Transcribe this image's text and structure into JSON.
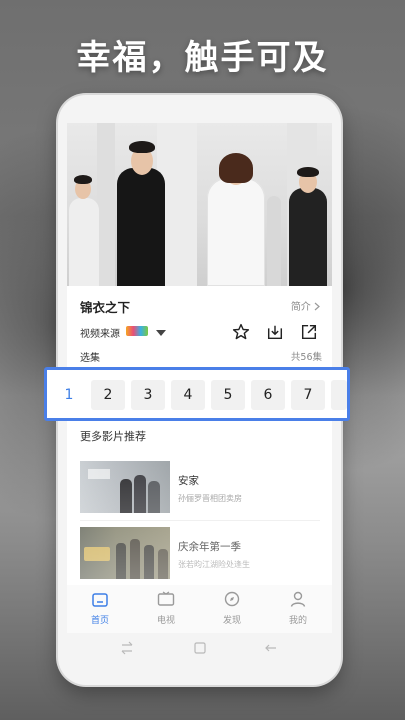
{
  "headline": "幸福，触手可及",
  "show": {
    "title": "锦衣之下",
    "intro_label": "简介",
    "source_label": "视频来源"
  },
  "episodes": {
    "label": "选集",
    "total": "共56集",
    "numbers": [
      "1",
      "2",
      "3",
      "4",
      "5",
      "6",
      "7"
    ],
    "active": "1"
  },
  "recommendations": {
    "title": "更多影片推荐",
    "items": [
      {
        "name": "安家",
        "desc": "孙俪罗晋相团卖房"
      },
      {
        "name": "庆余年第一季",
        "desc": "张若昀江湖险处逢生"
      }
    ]
  },
  "tabs": [
    {
      "label": "首页",
      "icon": "home-icon",
      "active": true
    },
    {
      "label": "电视",
      "icon": "tv-icon",
      "active": false
    },
    {
      "label": "发现",
      "icon": "compass-icon",
      "active": false
    },
    {
      "label": "我的",
      "icon": "user-icon",
      "active": false
    }
  ],
  "colors": {
    "accent": "#3d7ee6",
    "highlight_border": "#4a7fe8"
  }
}
